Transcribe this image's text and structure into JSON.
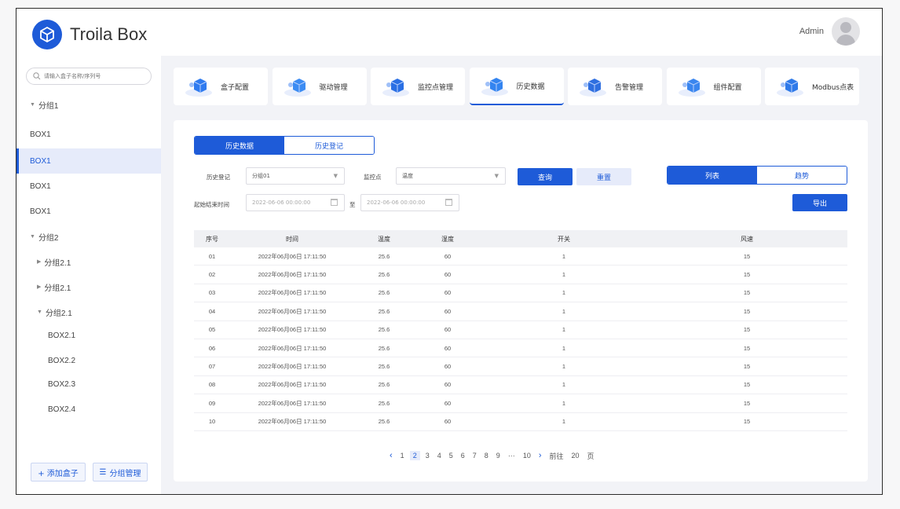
{
  "header": {
    "brand": "Troila Box",
    "user": "Admin"
  },
  "sidebar": {
    "search_placeholder": "请输入盒子名称/序列号",
    "items": [
      {
        "label": "分组1",
        "caret": "▼"
      },
      {
        "label": "BOX1"
      },
      {
        "label": "BOX1",
        "active": true
      },
      {
        "label": "BOX1"
      },
      {
        "label": "BOX1"
      },
      {
        "label": "分组2",
        "caret": "▼"
      },
      {
        "label": "分组2.1",
        "caret": "▶"
      },
      {
        "label": "分组2.1",
        "caret": "▶"
      },
      {
        "label": "分组2.1",
        "caret": "▼"
      },
      {
        "label": "BOX2.1"
      },
      {
        "label": "BOX2.2"
      },
      {
        "label": "BOX2.3"
      },
      {
        "label": "BOX2.4"
      }
    ],
    "add_box": "+ 添加盒子",
    "group_manage": "分组管理"
  },
  "tabs": [
    {
      "label": "盒子配置"
    },
    {
      "label": "驱动管理"
    },
    {
      "label": "监控点管理"
    },
    {
      "label": "历史数据",
      "active": true
    },
    {
      "label": "告警管理"
    },
    {
      "label": "组件配置"
    },
    {
      "label": "Modbus点表"
    }
  ],
  "panel": {
    "seg_left": {
      "on": "历史数据",
      "off": "历史登记"
    },
    "seg_right": {
      "on": "列表",
      "off": "趋势"
    },
    "filters": {
      "history_label": "历史登记",
      "history_value": "分组01",
      "point_label": "监控点",
      "point_value": "温度",
      "range_label": "起始结束时间",
      "start_placeholder": "2022-06-06 00:00:00",
      "to": "至",
      "end_placeholder": "2022-06-06 00:00:00"
    },
    "query": "查询",
    "reset": "重置",
    "export": "导出"
  },
  "table": {
    "columns": [
      "序号",
      "时间",
      "温度",
      "湿度",
      "开关",
      "风速"
    ],
    "rows": [
      [
        "01",
        "2022年06月06日 17:11:50",
        "25.6",
        "60",
        "1",
        "15"
      ],
      [
        "02",
        "2022年06月06日 17:11:50",
        "25.6",
        "60",
        "1",
        "15"
      ],
      [
        "03",
        "2022年06月06日 17:11:50",
        "25.6",
        "60",
        "1",
        "15"
      ],
      [
        "04",
        "2022年06月06日 17:11:50",
        "25.6",
        "60",
        "1",
        "15"
      ],
      [
        "05",
        "2022年06月06日 17:11:50",
        "25.6",
        "60",
        "1",
        "15"
      ],
      [
        "06",
        "2022年06月06日 17:11:50",
        "25.6",
        "60",
        "1",
        "15"
      ],
      [
        "07",
        "2022年06月06日 17:11:50",
        "25.6",
        "60",
        "1",
        "15"
      ],
      [
        "08",
        "2022年06月06日 17:11:50",
        "25.6",
        "60",
        "1",
        "15"
      ],
      [
        "09",
        "2022年06月06日 17:11:50",
        "25.6",
        "60",
        "1",
        "15"
      ],
      [
        "10",
        "2022年06月06日 17:11:50",
        "25.6",
        "60",
        "1",
        "15"
      ]
    ]
  },
  "pager": {
    "prev": "‹",
    "pages": [
      "1",
      "2",
      "3",
      "4",
      "5",
      "6",
      "7",
      "8",
      "9"
    ],
    "current": "2",
    "ellipsis": "···",
    "last": "10",
    "next": "›",
    "goto_label": "前往",
    "goto_value": "20",
    "page_suffix": "页"
  },
  "colors": {
    "accent": "#1e5bd8",
    "accent_light": "#e6ebfa"
  }
}
